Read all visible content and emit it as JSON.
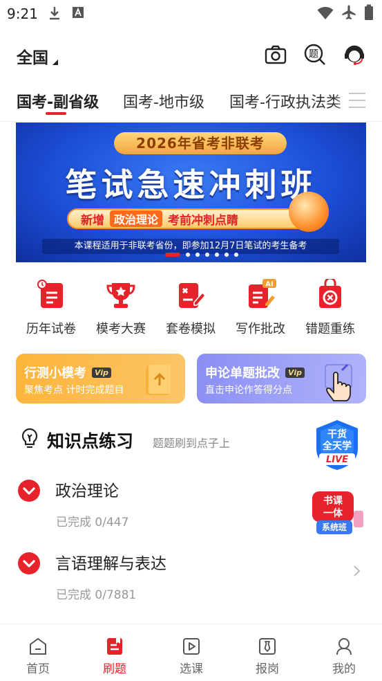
{
  "status_bar": {
    "time": "9:21"
  },
  "header": {
    "region": "全国"
  },
  "tabs": [
    {
      "label": "国考-副省级",
      "active": true
    },
    {
      "label": "国考-地市级",
      "active": false
    },
    {
      "label": "国考-行政执法类",
      "active": false
    }
  ],
  "banner": {
    "pill": "2026年省考非联考",
    "title": "笔试急速冲刺班",
    "strip_prefix": "新增",
    "strip_highlight": "政治理论",
    "strip_suffix": "考前冲刺点睛",
    "subtitle": "本课程适用于非联考省份，即参加12月7日笔试的考生备考",
    "slide_count": 7,
    "active_slide": 1
  },
  "quick_entries": [
    {
      "label": "历年试卷",
      "icon": "history-paper-icon"
    },
    {
      "label": "模考大赛",
      "icon": "trophy-icon"
    },
    {
      "label": "套卷模拟",
      "icon": "mock-paper-icon"
    },
    {
      "label": "写作批改",
      "icon": "ai-writing-icon",
      "tag": "AI"
    },
    {
      "label": "错题重练",
      "icon": "wrong-question-icon"
    }
  ],
  "promo_cards": [
    {
      "title": "行测小模考",
      "vip": "Vip",
      "subtitle": "聚焦考点 计时完成题目",
      "color": "#fbb342"
    },
    {
      "title": "申论单题批改",
      "vip": "Vip",
      "subtitle": "直击申论作答得分点",
      "color": "#8f95f5"
    }
  ],
  "knowledge": {
    "title": "知识点练习",
    "subtitle": "题题刷到点子上",
    "badge_live": [
      "干货",
      "全天学",
      "LIVE"
    ],
    "badge_course": [
      "书课",
      "一体",
      "系统班"
    ],
    "items": [
      {
        "name": "政治理论",
        "progress_label": "已完成",
        "progress": "0/447"
      },
      {
        "name": "言语理解与表达",
        "progress_label": "已完成",
        "progress": "0/7881"
      }
    ]
  },
  "bottom_nav": [
    {
      "label": "首页",
      "active": false
    },
    {
      "label": "刷题",
      "active": true
    },
    {
      "label": "选课",
      "active": false
    },
    {
      "label": "报岗",
      "active": false
    },
    {
      "label": "我的",
      "active": false
    }
  ],
  "colors": {
    "accent": "#e6222b",
    "banner_blue": "#1d4fd8",
    "orange_card": "#fbb342",
    "purple_card": "#8f95f5"
  }
}
